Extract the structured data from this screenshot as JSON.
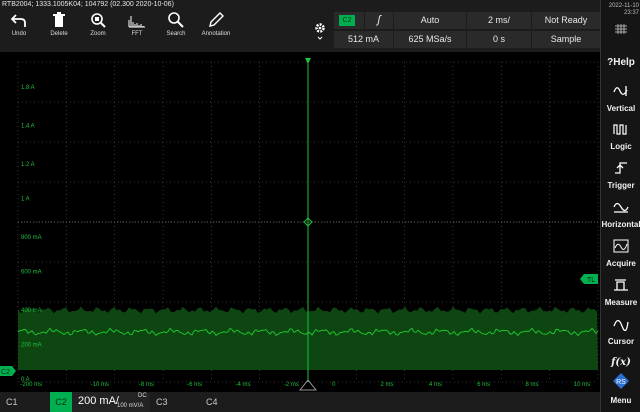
{
  "header": {
    "model_id": "RTB2004; 1333.1005K04; 104792 (02.300 2020-10-06)"
  },
  "toolbar": [
    {
      "label": "Undo",
      "icon": "undo-icon"
    },
    {
      "label": "Delete",
      "icon": "trash-icon"
    },
    {
      "label": "Zoom",
      "icon": "zoom-icon"
    },
    {
      "label": "FFT",
      "icon": "fft-icon"
    },
    {
      "label": "Search",
      "icon": "search-icon"
    },
    {
      "label": "Annotation",
      "icon": "pencil-icon"
    }
  ],
  "acquisition": {
    "channel_badge": "C2",
    "edge_symbol": "ʃ",
    "trigger_mode": "Auto",
    "time_scale": "2 ms/",
    "status": "Not Ready",
    "trigger_level": "512 mA",
    "sample_rate": "625 MSa/s",
    "horizontal_position": "0 s",
    "acquire_mode": "Sample"
  },
  "sidebar": {
    "date": "2022-11-10",
    "time": "23:37",
    "items": [
      {
        "label": "Help",
        "icon": "help-icon"
      },
      {
        "label": "Vertical",
        "icon": "vertical-icon"
      },
      {
        "label": "Logic",
        "icon": "logic-icon"
      },
      {
        "label": "Trigger",
        "icon": "trigger-icon"
      },
      {
        "label": "Horizontal",
        "icon": "horizontal-icon"
      },
      {
        "label": "Acquire",
        "icon": "acquire-icon"
      },
      {
        "label": "Measure",
        "icon": "measure-icon"
      },
      {
        "label": "Cursor",
        "icon": "cursor-icon"
      },
      {
        "label": "Menu",
        "icon": "menu-icon"
      }
    ],
    "fx_label": "f(x)"
  },
  "waveform": {
    "y_labels": [
      "1.8 A",
      "1.4 A",
      "1.2 A",
      "1 A",
      "800 mA",
      "600 mA",
      "400 mA",
      "200 mA",
      "0 A"
    ],
    "x_labels": [
      "-200 ms",
      "-10 ms",
      "-8 ms",
      "-6 ms",
      "-4 ms",
      "-2 ms",
      "0",
      "2 ms",
      "4 ms",
      "6 ms",
      "8 ms",
      "10 ms"
    ],
    "trigger_level_marker": "TL",
    "channel_marker": "C2",
    "trace_color": "#22cc33",
    "grid_color": "#444444"
  },
  "bottombar": {
    "channels": [
      "C1",
      "C3",
      "C4"
    ],
    "active_channel": "C2",
    "active_scale": "200 mA/",
    "coupling": "DC",
    "probe": "100 mV/A"
  },
  "colors": {
    "accent_green": "#00b050",
    "background": "#000000",
    "panel": "#1c1c1c"
  }
}
